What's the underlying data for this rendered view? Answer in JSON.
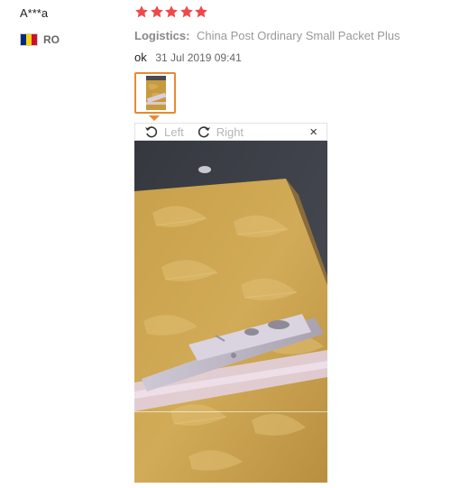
{
  "reviewer": {
    "name": "A***a",
    "country_code": "RO",
    "flag_colors": [
      "#002B7F",
      "#FCD116",
      "#CE1126"
    ]
  },
  "rating": {
    "stars": 5,
    "max_stars": 5,
    "star_color": "#f0494a"
  },
  "logistics": {
    "label": "Logistics:",
    "value": "China Post Ordinary Small Packet Plus"
  },
  "feedback": {
    "text": "ok",
    "date": "31 Jul 2019 09:41"
  },
  "viewer": {
    "rotate_left_label": "Left",
    "rotate_right_label": "Right",
    "close_glyph": "×",
    "image_description": "photo of straight razor on yellow leaf-pattern cloth"
  },
  "colors": {
    "thumb_border": "#e98a2f"
  }
}
